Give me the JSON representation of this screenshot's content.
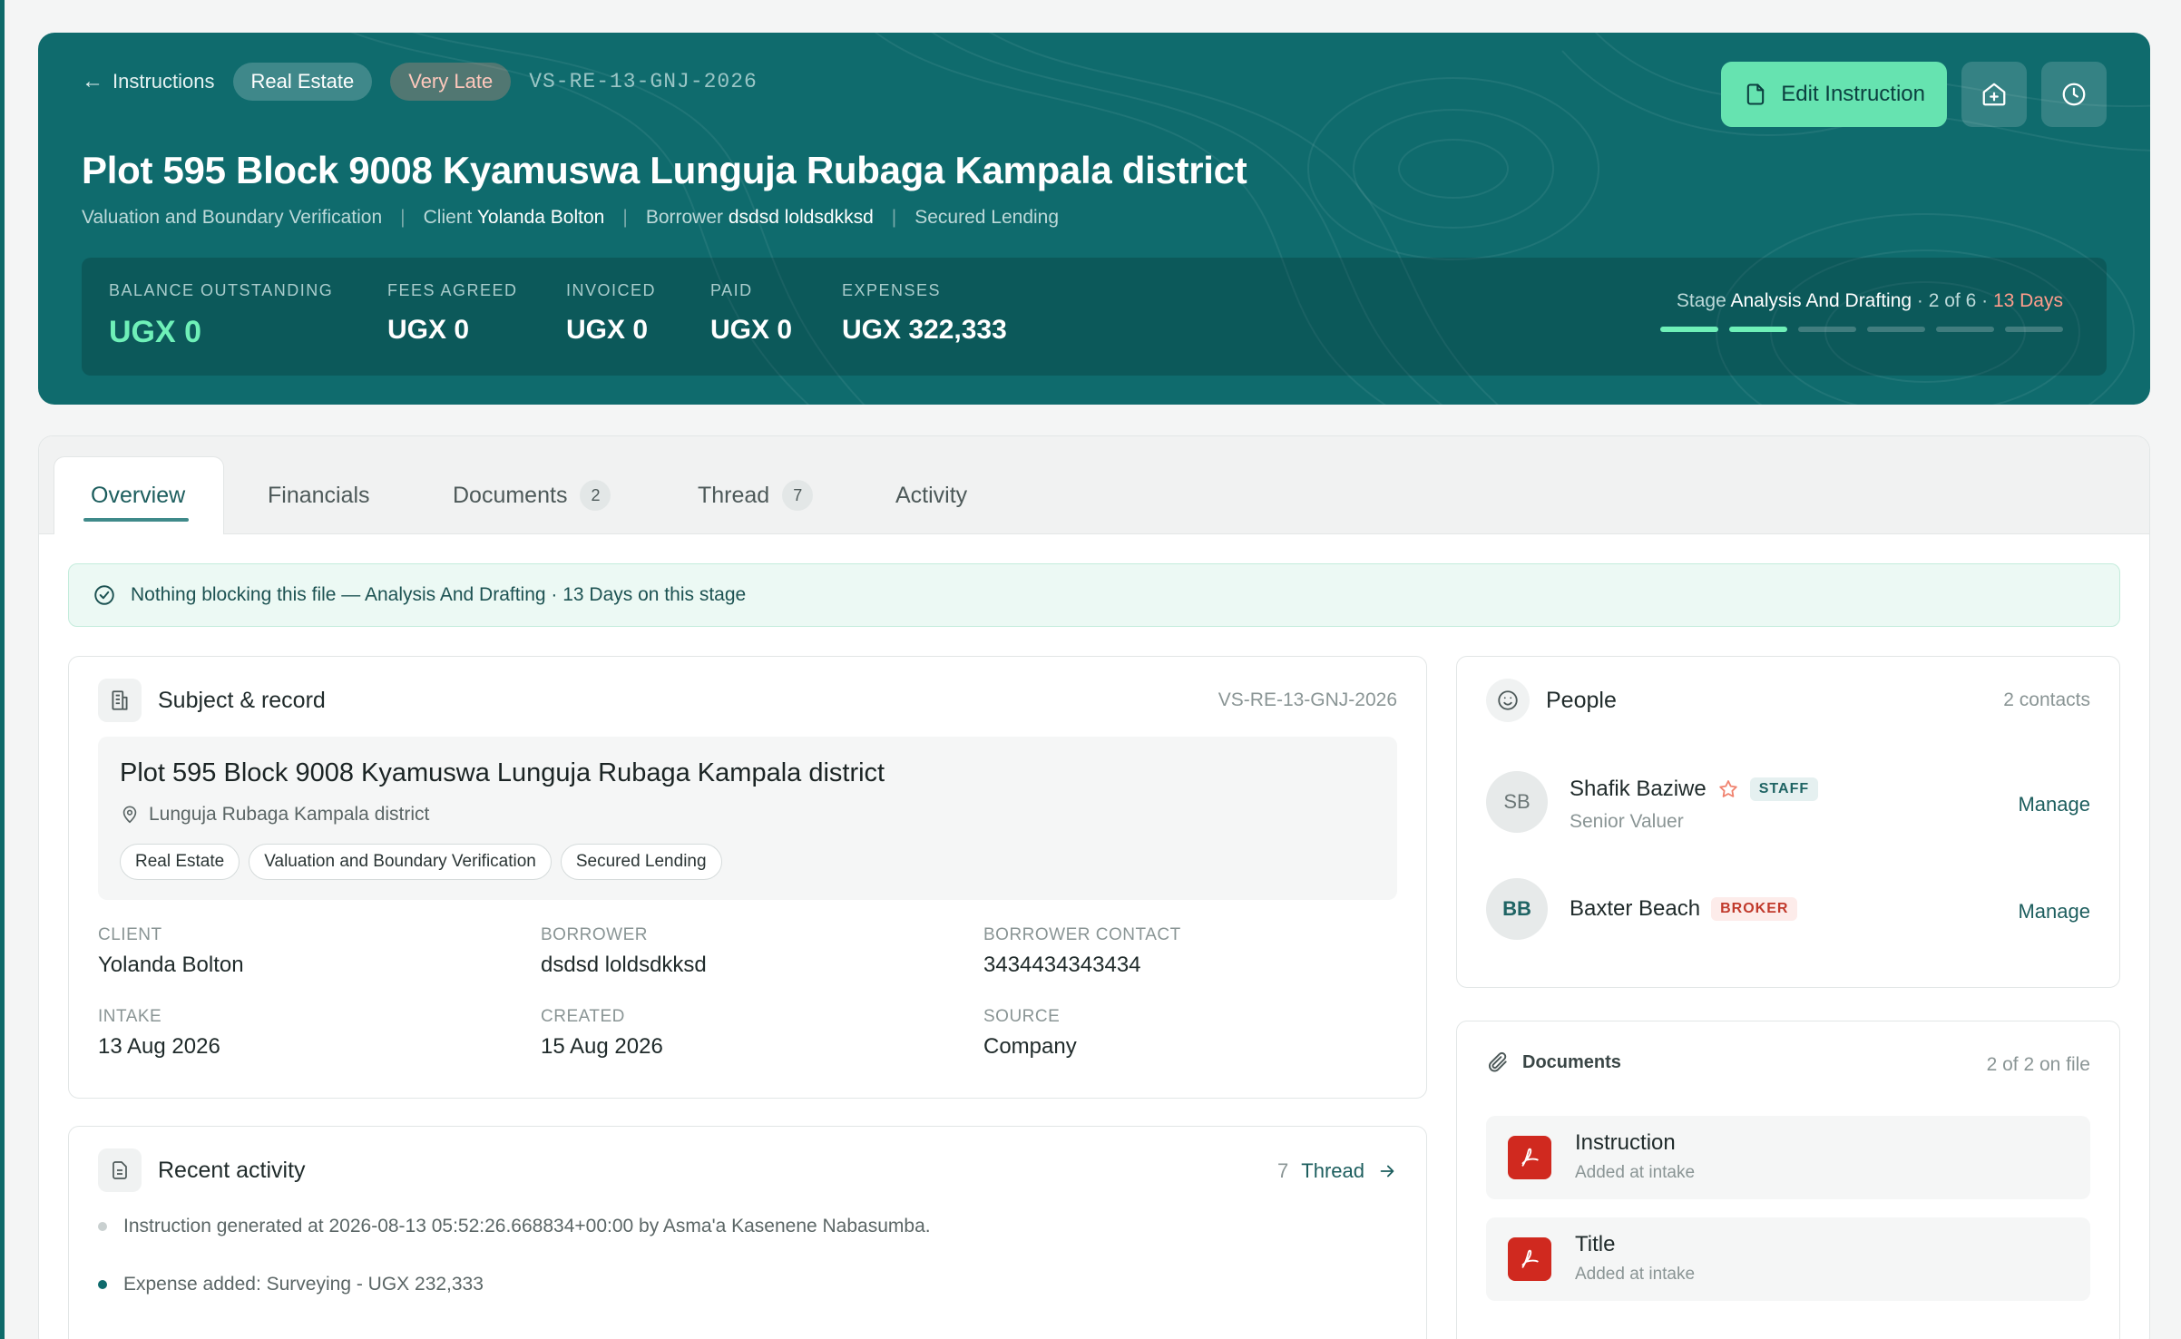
{
  "header": {
    "back_label": "Instructions",
    "type_pill": "Real Estate",
    "status_pill": "Very Late",
    "ref": "VS-RE-13-GNJ-2026",
    "edit_label": "Edit Instruction",
    "title": "Plot 595 Block 9008 Kyamuswa Lunguja Rubaga Kampala district",
    "service": "Valuation and Boundary Verification",
    "client_label": "Client",
    "client": "Yolanda Bolton",
    "borrower_label": "Borrower",
    "borrower": "dsdsd loldsdkksd",
    "purpose": "Secured Lending"
  },
  "stats": {
    "balance": {
      "label": "BALANCE OUTSTANDING",
      "value": "UGX 0"
    },
    "fees": {
      "label": "FEES AGREED",
      "value": "UGX 0"
    },
    "invoiced": {
      "label": "INVOICED",
      "value": "UGX 0"
    },
    "paid": {
      "label": "PAID",
      "value": "UGX 0"
    },
    "expenses": {
      "label": "EXPENSES",
      "value": "UGX 322,333"
    }
  },
  "stage": {
    "prefix": "Stage",
    "name": "Analysis And Drafting",
    "progress_text": "· 2 of 6 ·",
    "days": "13 Days",
    "current": 2,
    "total": 6
  },
  "tabs": {
    "overview": "Overview",
    "financials": "Financials",
    "documents": "Documents",
    "documents_count": "2",
    "thread": "Thread",
    "thread_count": "7",
    "activity": "Activity"
  },
  "notice": {
    "strong": "Nothing blocking this file",
    "rest": " — Analysis And Drafting · 13 Days on this stage"
  },
  "subject": {
    "heading": "Subject & record",
    "ref": "VS-RE-13-GNJ-2026",
    "title": "Plot 595 Block 9008 Kyamuswa Lunguja Rubaga Kampala district",
    "location": "Lunguja Rubaga Kampala district",
    "tags": [
      "Real Estate",
      "Valuation and Boundary Verification",
      "Secured Lending"
    ],
    "fields": {
      "client": {
        "k": "CLIENT",
        "v": "Yolanda Bolton"
      },
      "borrower": {
        "k": "BORROWER",
        "v": "dsdsd loldsdkksd"
      },
      "borrower_contact": {
        "k": "BORROWER CONTACT",
        "v": "3434434343434"
      },
      "intake": {
        "k": "INTAKE",
        "v": "13 Aug 2026"
      },
      "created": {
        "k": "CREATED",
        "v": "15 Aug 2026"
      },
      "source": {
        "k": "SOURCE",
        "v": "Company"
      }
    }
  },
  "activity": {
    "heading": "Recent activity",
    "count": "7",
    "link": "Thread",
    "items": [
      "Instruction generated at 2026-08-13 05:52:26.668834+00:00 by Asma'a Kasenene Nabasumba.",
      "Expense added: Surveying - UGX 232,333"
    ]
  },
  "people": {
    "heading": "People",
    "count": "2 contacts",
    "list": [
      {
        "initials": "SB",
        "name": "Shafik Baziwe",
        "badge": "STAFF",
        "role": "Senior Valuer",
        "action": "Manage"
      },
      {
        "initials": "BB",
        "name": "Baxter Beach",
        "badge": "BROKER",
        "role": "",
        "action": "Manage"
      }
    ]
  },
  "documents": {
    "heading": "Documents",
    "count": "2 of 2 on file",
    "list": [
      {
        "name": "Instruction",
        "sub": "Added at intake"
      },
      {
        "name": "Title",
        "sub": "Added at intake"
      }
    ]
  },
  "colors": {
    "hero": "#0f6b6d",
    "accent": "#66e3b0",
    "late": "#ff9d8c",
    "pdf": "#d0291f"
  },
  "icons": [
    "arrow-left-icon",
    "document-icon",
    "house-plus-icon",
    "clock-icon",
    "check-circle-icon",
    "building-icon",
    "map-pin-icon",
    "smile-icon",
    "star-icon",
    "paperclip-icon",
    "pdf-icon",
    "arrow-right-icon"
  ]
}
